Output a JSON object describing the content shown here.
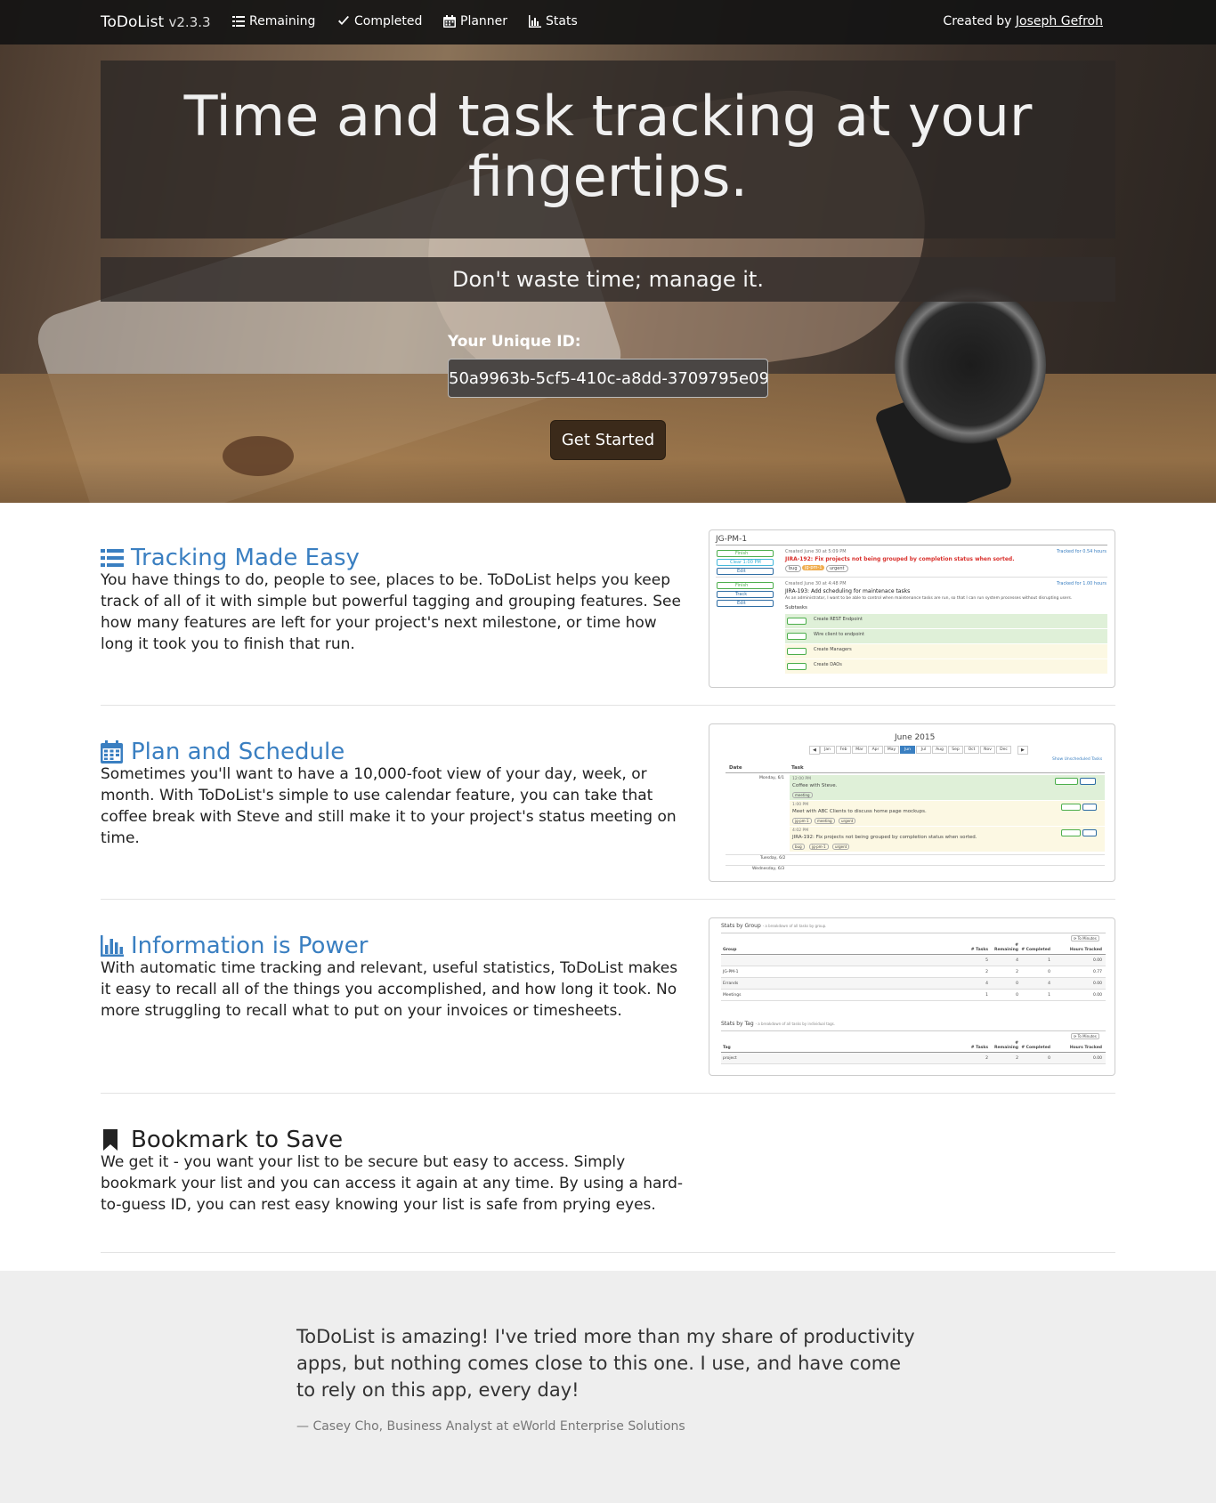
{
  "nav": {
    "brand": "ToDoList",
    "version": "v2.3.3",
    "items": [
      {
        "label": "Remaining",
        "icon": "list-icon"
      },
      {
        "label": "Completed",
        "icon": "check-icon"
      },
      {
        "label": "Planner",
        "icon": "calendar-icon"
      },
      {
        "label": "Stats",
        "icon": "bar-chart-icon"
      }
    ],
    "credit_prefix": "Created by ",
    "credit_name": "Joseph Gefroh"
  },
  "hero": {
    "headline": "Time and task tracking at your fingertips.",
    "subline": "Don't waste time; manage it.",
    "uid_label": "Your Unique ID:",
    "uid_value": "50a9963b-5cf5-410c-a8dd-3709795e09",
    "cta": "Get Started"
  },
  "features": [
    {
      "title": "Tracking Made Easy",
      "icon": "list-icon",
      "body": "You have things to do, people to see, places to be. ToDoList helps you keep track of all of it with simple but powerful tagging and grouping features. See how many features are left for your project's next milestone, or time how long it took you to finish that run.",
      "screenshot": {
        "group": "JG-PM-1",
        "task1_created": "Created June 30 at 5:09 PM",
        "task1_title": "JIRA-192: Fix projects not being grouped by completion status when sorted.",
        "task1_tracked": "Tracked for 0.54 hours",
        "task1_tags": [
          "bug",
          "jg-pm-1",
          "urgent"
        ],
        "task2_created": "Created June 30 at 4:48 PM",
        "task2_title": "JIRA-193: Add scheduling for maintenace tasks",
        "task2_desc": "As an administrator, I want to be able to control when maintenance tasks are run, so that I can run system processes without disrupting users.",
        "task2_tracked": "Tracked for 1.00 hours",
        "subtasks_label": "Subtasks",
        "subtasks": [
          "Create REST Endpoint",
          "Wire client to endpoint",
          "Create Managers",
          "Create DAOs"
        ],
        "buttons": [
          "Finish",
          "Clear 1:00 PM",
          "Edit",
          "Finish",
          "Track",
          "Edit"
        ]
      }
    },
    {
      "title": "Plan and Schedule",
      "icon": "calendar-icon",
      "body": "Sometimes you'll want to have a 10,000-foot view of your day, week, or month. With ToDoList's simple to use calendar feature, you can take that coffee break with Steve and still make it to your project's status meeting on time.",
      "screenshot": {
        "month_title": "June 2015",
        "months": [
          "Jan",
          "Feb",
          "Mar",
          "Apr",
          "May",
          "Jun",
          "Jul",
          "Aug",
          "Sep",
          "Oct",
          "Nov",
          "Dec"
        ],
        "active_month": "Jun",
        "show_link": "Show Unscheduled Tasks",
        "col_date": "Date",
        "col_task": "Task",
        "day1": "Monday, 6/1",
        "entries": [
          {
            "time": "12:00 PM",
            "title": "Coffee with Steve.",
            "tags": [
              "meeting"
            ]
          },
          {
            "time": "1:00 PM",
            "title": "Meet with ABC Clients to discuss home page mockups.",
            "tags": [
              "jg-pm-1",
              "meeting",
              "urgent"
            ]
          },
          {
            "time": "4:02 PM",
            "title": "JIRA-192: Fix projects not being grouped by completion status when sorted.",
            "tags": [
              "bug",
              "jg-pm-1",
              "urgent"
            ]
          }
        ],
        "day2": "Tuesday, 6/2",
        "day3": "Wednesday, 6/3"
      }
    },
    {
      "title": "Information is Power",
      "icon": "bar-chart-icon",
      "body": "With automatic time tracking and relevant, useful statistics, ToDoList makes it easy to recall all of the things you accomplished, and how long it took. No more struggling to recall what to put on your invoices or timesheets.",
      "screenshot": {
        "group_title": "Stats by Group",
        "group_sub": "- a breakdown of all tasks by group.",
        "tag_title": "Stats by Tag",
        "tag_sub": "- a breakdown of all tasks by individual tags.",
        "toggle": "To Minutes",
        "headers": [
          "Group",
          "# Tasks",
          "# Remaining",
          "# Completed",
          "Hours Tracked"
        ],
        "tag_headers": [
          "Tag",
          "# Tasks",
          "# Remaining",
          "# Completed",
          "Hours Tracked"
        ],
        "group_rows": [
          [
            "",
            "5",
            "4",
            "1",
            "0.00"
          ],
          [
            "JG-PM-1",
            "2",
            "2",
            "0",
            "0.77"
          ],
          [
            "Errands",
            "4",
            "0",
            "4",
            "0.00"
          ],
          [
            "Meetings",
            "1",
            "0",
            "1",
            "0.00"
          ]
        ],
        "tag_rows": [
          [
            "project",
            "2",
            "2",
            "0",
            "0.00"
          ]
        ]
      }
    },
    {
      "title": "Bookmark to Save",
      "icon": "bookmark-icon",
      "body": "We get it - you want your list to be secure but easy to access. Simply bookmark your list and you can access it again at any time. By using a hard-to-guess ID, you can rest easy knowing your list is safe from prying eyes."
    }
  ],
  "testimonial": {
    "quote": "ToDoList is amazing! I've tried more than my share of productivity apps, but nothing comes close to this one. I use, and have come to rely on this app, every day!",
    "cite": "— Casey Cho, Business Analyst at eWorld Enterprise Solutions"
  }
}
